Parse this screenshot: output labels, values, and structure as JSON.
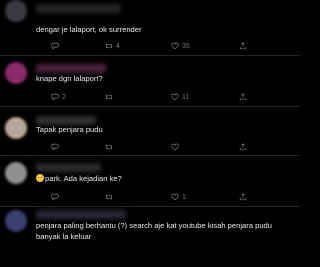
{
  "feed": {
    "replies": [
      {
        "text": "dengar je lalaport, ok surrender",
        "reply_count": "",
        "retweet_count": "4",
        "like_count": "35",
        "avatar_color": "#3a3a40",
        "header_color": "#2c2c30"
      },
      {
        "text": "knape dgn lalaport?",
        "reply_count": "2",
        "retweet_count": "",
        "like_count": "11",
        "avatar_color": "#8a2b6a",
        "header_color": "#5a2a4a"
      },
      {
        "text": "Tapak penjara pudu",
        "reply_count": "",
        "retweet_count": "",
        "like_count": "",
        "avatar_color": "#b7a8a0",
        "header_color": "#3c3a3c"
      },
      {
        "emoji": "smiling-face-emoji",
        "text": "park. Ada kejadian ke?",
        "reply_count": "",
        "retweet_count": "",
        "like_count": "1",
        "avatar_color": "#8f8f8f",
        "header_color": "#333333"
      },
      {
        "text": "penjara paling berhantu (?) search aje kat youtube kisah penjara pudu banyak la keluar",
        "reply_count": "",
        "retweet_count": "",
        "like_count": "",
        "avatar_color": "#3a3f6e",
        "header_color": "#2e2f40"
      }
    ]
  },
  "icons": {
    "reply": "reply-icon",
    "retweet": "retweet-icon",
    "like": "like-icon",
    "share": "share-icon"
  },
  "colors": {
    "background": "#000000",
    "text": "#e7e9ea",
    "muted": "#71767b",
    "divider": "#202327"
  }
}
